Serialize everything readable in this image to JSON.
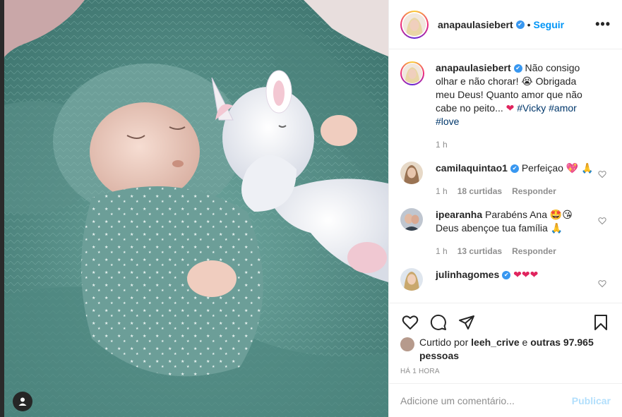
{
  "post": {
    "author": "anapaulasiebert",
    "follow_label": "Seguir",
    "separator": "•",
    "more_label": "•••",
    "caption_author": "anapaulasiebert",
    "caption_text": "Não consigo olhar e não chorar! 😭 Obrigada meu Deus! Quanto amor que não cabe no peito... ",
    "caption_heart": "❤",
    "hashtags": [
      "#Vicky",
      "#amor",
      "#love"
    ],
    "caption_time": "1 h"
  },
  "comments": [
    {
      "user": "camilaquintao1",
      "text": "Perfeiçao 💖 🙏",
      "time": "1 h",
      "likes": "18 curtidas",
      "reply": "Responder"
    },
    {
      "user": "ipearanha",
      "text": "Parabéns Ana 🤩😘 Deus abençoe tua família 🙏",
      "time": "1 h",
      "likes": "13 curtidas",
      "reply": "Responder"
    },
    {
      "user": "julinhagomes",
      "text": "❤❤❤",
      "time": "",
      "likes": "",
      "reply": ""
    }
  ],
  "likes": {
    "prefix": "Curtido por",
    "user": "leeh_crive",
    "middle": "e",
    "others": "outras 97.965 pessoas"
  },
  "timestamp": "HÁ 1 HORA",
  "comment_box": {
    "placeholder": "Adicione um comentário...",
    "publish_label": "Publicar"
  },
  "icons": {
    "like": "heart-icon",
    "comment": "comment-icon",
    "share": "send-icon",
    "save": "bookmark-icon",
    "tag": "user-tag-icon",
    "verified": "verified-badge-icon",
    "comment_like": "small-heart-icon"
  },
  "colors": {
    "link_blue": "#0095f6",
    "verified_blue": "#3897f0",
    "hashtag": "#00376b",
    "muted": "#8e8e8e",
    "publish_disabled": "#b2dffc"
  }
}
